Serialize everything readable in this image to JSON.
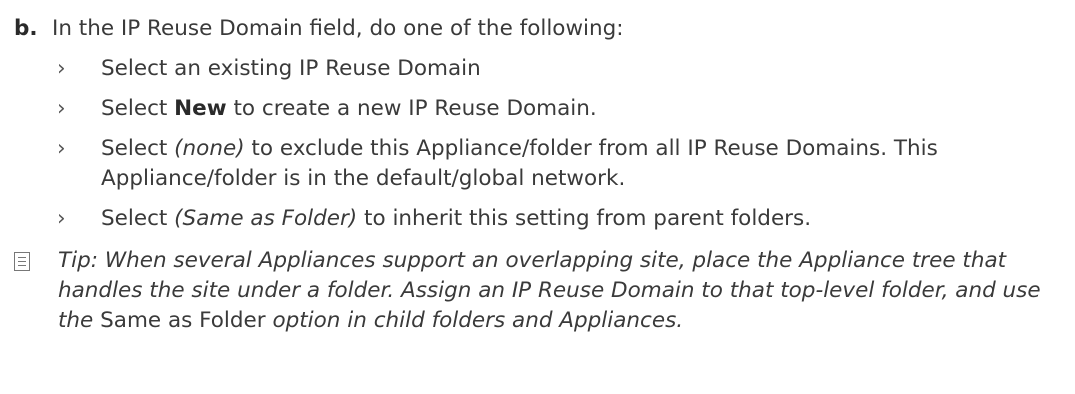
{
  "step": {
    "marker": "b.",
    "text": "In the IP Reuse Domain field, do one of the following:"
  },
  "bullet_glyph": "›",
  "options": [
    {
      "pre": "Select an existing IP Reuse Domain",
      "emph": "",
      "post": ""
    },
    {
      "pre": "Select ",
      "emph": "New",
      "post": " to create a new IP Reuse Domain."
    },
    {
      "pre": "Select ",
      "emph": "(none)",
      "post": " to exclude this Appliance/folder from all IP Reuse Domains. This Appliance/folder is in the default/global network."
    },
    {
      "pre": "Select ",
      "emph": "(Same as Folder)",
      "post": " to inherit this setting from parent folders."
    }
  ],
  "tip": {
    "icon": "note-icon",
    "text_before": "Tip: When several Appliances support an overlapping site, place the Appliance tree that handles the site under a folder. Assign an IP Reuse Domain to that top-level folder, and use the ",
    "emph": "Same as Folder",
    "text_after": " option in child folders and Appliances."
  }
}
